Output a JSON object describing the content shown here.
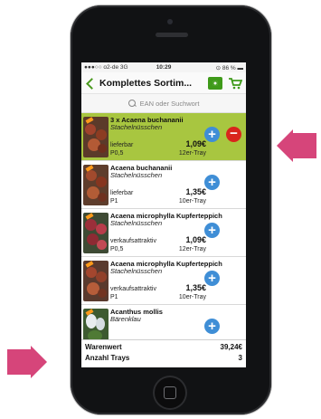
{
  "statusbar": {
    "carrier": "●●●○○ o2-de  3G",
    "time": "10:29",
    "battery": "⊙ 86 % ▬"
  },
  "nav": {
    "title": "Komplettes Sortim..."
  },
  "search": {
    "placeholder": "EAN oder Suchwort"
  },
  "items": [
    {
      "name": "3 x Acaena buchananii",
      "sub": "Stachelnüsschen",
      "avail": "lieferbar",
      "code": "P0,5",
      "price": "1,09€",
      "pack": "12er-Tray"
    },
    {
      "name": "Acaena buchananii",
      "sub": "Stachelnüsschen",
      "avail": "lieferbar",
      "code": "P1",
      "price": "1,35€",
      "pack": "10er-Tray"
    },
    {
      "name": "Acaena microphylla Kupferteppich",
      "sub": "Stachelnüsschen",
      "avail": "verkaufsattraktiv",
      "code": "P0,5",
      "price": "1,09€",
      "pack": "12er-Tray"
    },
    {
      "name": "Acaena microphylla Kupferteppich",
      "sub": "Stachelnüsschen",
      "avail": "verkaufsattraktiv",
      "code": "P1",
      "price": "1,35€",
      "pack": "10er-Tray"
    },
    {
      "name": "Acanthus mollis",
      "sub": "Bärenklau",
      "avail": "",
      "code": "",
      "price": "",
      "pack": ""
    }
  ],
  "buttons": {
    "plus": "+",
    "minus": "−"
  },
  "footer": {
    "warenwert_label": "Warenwert",
    "warenwert_value": "39,24€",
    "trays_label": "Anzahl Trays",
    "trays_value": "3"
  },
  "colors": {
    "accent_green": "#4a9a1e",
    "selected_row": "#a8c640",
    "plus_blue": "#3f8ed6",
    "minus_red": "#d9251c",
    "arrow": "#d6457a"
  },
  "icons": {
    "back": "chevron-left-icon",
    "camera": "camera-icon",
    "cart": "cart-icon",
    "search": "search-icon"
  }
}
